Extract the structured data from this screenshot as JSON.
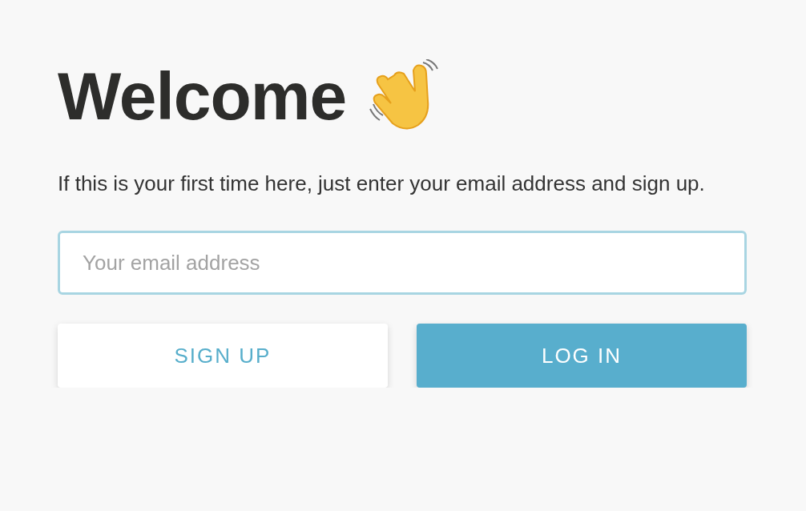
{
  "heading": "Welcome",
  "intro": "If this is your first time here, just enter your email address and sign up.",
  "email_field": {
    "placeholder": "Your email address"
  },
  "buttons": [
    {
      "label": "SIGN UP",
      "kind": "secondary"
    },
    {
      "label": "LOG IN",
      "kind": "primary"
    }
  ]
}
